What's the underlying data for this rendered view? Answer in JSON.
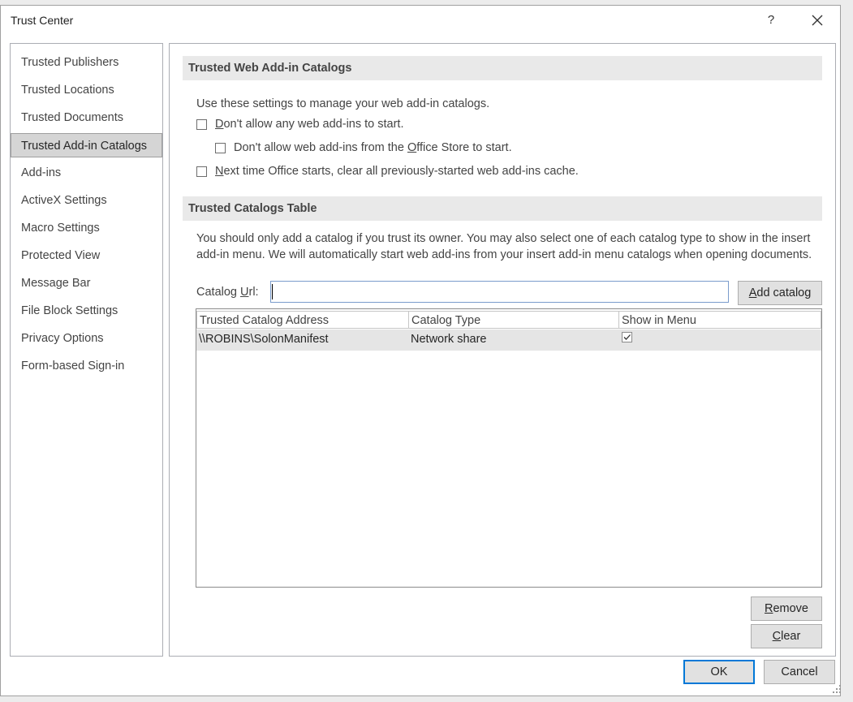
{
  "window": {
    "title": "Trust Center",
    "help_label": "?"
  },
  "nav": {
    "items": [
      {
        "label": "Trusted Publishers"
      },
      {
        "label": "Trusted Locations"
      },
      {
        "label": "Trusted Documents"
      },
      {
        "label": "Trusted Add-in Catalogs",
        "selected": true
      },
      {
        "label": "Add-ins"
      },
      {
        "label": "ActiveX Settings"
      },
      {
        "label": "Macro Settings"
      },
      {
        "label": "Protected View"
      },
      {
        "label": "Message Bar"
      },
      {
        "label": "File Block Settings"
      },
      {
        "label": "Privacy Options"
      },
      {
        "label": "Form-based Sign-in"
      }
    ]
  },
  "web_addins": {
    "header": "Trusted Web Add-in Catalogs",
    "intro": "Use these settings to manage your web add-in catalogs.",
    "opt_disallow_all": {
      "access": "D",
      "rest": "on't allow any web add-ins to start.",
      "checked": false
    },
    "opt_disallow_store": {
      "pre": "Don't allow web add-ins from the ",
      "access": "O",
      "rest": "ffice Store to start.",
      "checked": false
    },
    "opt_clear_cache": {
      "access": "N",
      "rest": "ext time Office starts, clear all previously-started web add-ins cache.",
      "checked": false
    }
  },
  "catalogs": {
    "header": "Trusted Catalogs Table",
    "description": "You should only add a catalog if you trust its owner. You may also select one of each catalog type to show in the insert add-in menu. We will automatically start web add-ins from your insert add-in menu catalogs when opening documents.",
    "url_label_pre": "Catalog ",
    "url_label_access": "U",
    "url_label_post": "rl:",
    "url_value": "",
    "add_button": {
      "access": "A",
      "rest": "dd catalog"
    },
    "columns": [
      "Trusted Catalog Address",
      "Catalog Type",
      "Show in Menu"
    ],
    "rows": [
      {
        "address": "\\\\ROBINS\\SolonManifest",
        "type": "Network share",
        "show_in_menu": true
      }
    ],
    "remove_button": {
      "access": "R",
      "rest": "emove"
    },
    "clear_button": {
      "access": "C",
      "rest": "lear"
    }
  },
  "footer": {
    "ok": "OK",
    "cancel": "Cancel"
  }
}
